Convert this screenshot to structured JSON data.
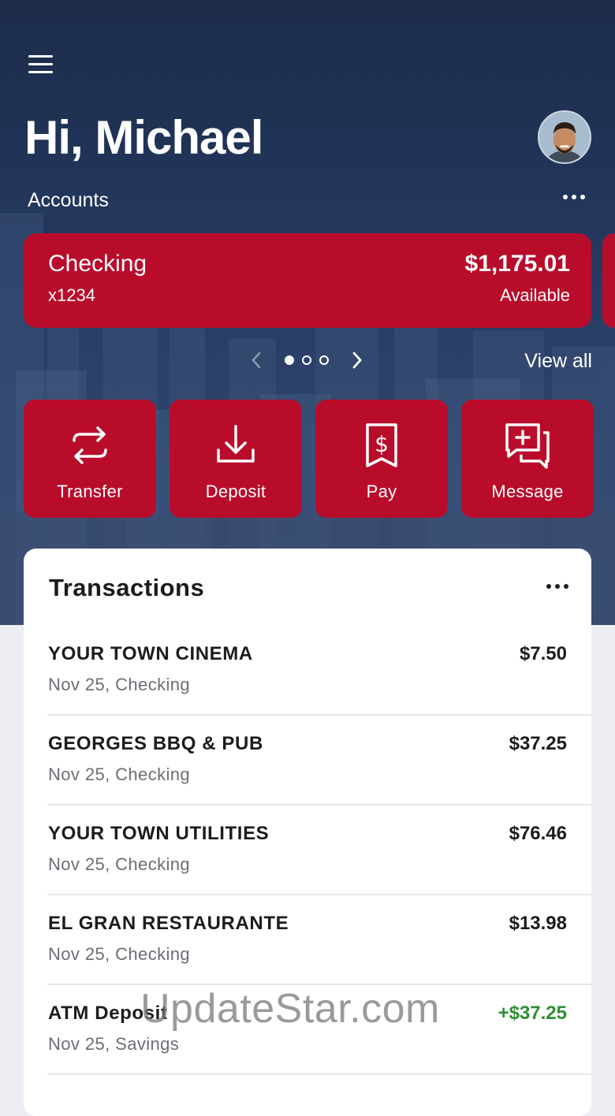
{
  "header": {
    "greeting": "Hi, Michael"
  },
  "accounts": {
    "label": "Accounts",
    "card": {
      "name": "Checking",
      "number": "x1234",
      "balance": "$1,175.01",
      "balance_label": "Available"
    },
    "pager": {
      "total": 3,
      "active_index": 0
    },
    "view_all": "View all"
  },
  "actions": [
    {
      "label": "Transfer",
      "icon": "transfer-arrows-icon"
    },
    {
      "label": "Deposit",
      "icon": "deposit-download-icon"
    },
    {
      "label": "Pay",
      "icon": "receipt-dollar-icon"
    },
    {
      "label": "Message",
      "icon": "message-plus-icon"
    }
  ],
  "transactions": {
    "title": "Transactions",
    "items": [
      {
        "name": "YOUR TOWN CINEMA",
        "detail": "Nov 25, Checking",
        "amount": "$7.50",
        "type": "debit"
      },
      {
        "name": "GEORGES BBQ & PUB",
        "detail": "Nov 25, Checking",
        "amount": "$37.25",
        "type": "debit"
      },
      {
        "name": "YOUR TOWN UTILITIES",
        "detail": "Nov 25, Checking",
        "amount": "$76.46",
        "type": "debit"
      },
      {
        "name": "EL GRAN RESTAURANTE",
        "detail": "Nov 25, Checking",
        "amount": "$13.98",
        "type": "debit"
      },
      {
        "name": "ATM Deposit",
        "detail": "Nov 25, Savings",
        "amount": "+$37.25",
        "type": "credit"
      }
    ]
  },
  "watermark": "UpdateStar.com",
  "colors": {
    "brand_red": "#b90c2b",
    "hero_navy": "#22355a",
    "credit_green": "#2f8f2f"
  }
}
